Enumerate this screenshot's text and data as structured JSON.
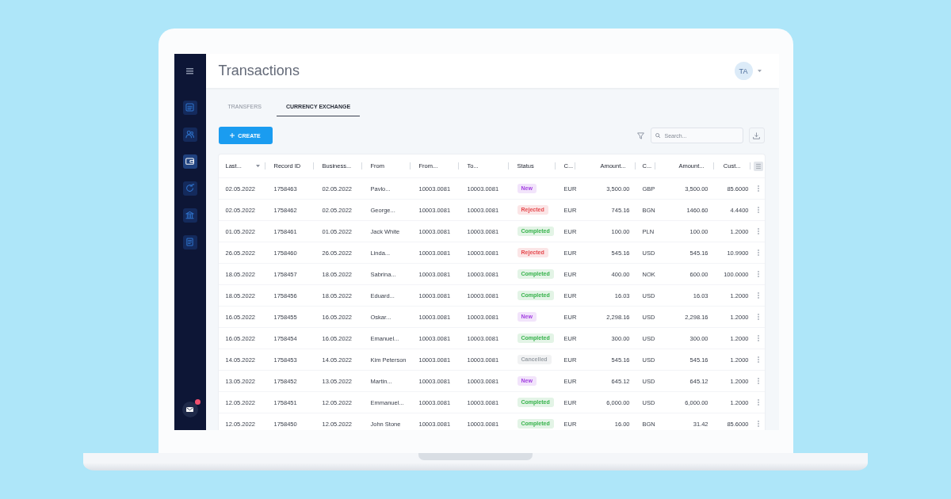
{
  "sidebar": {
    "items": [
      {
        "kind": "list",
        "selected": false
      },
      {
        "kind": "users",
        "selected": false
      },
      {
        "kind": "wallet",
        "selected": true
      },
      {
        "kind": "refresh",
        "selected": false
      },
      {
        "kind": "bank",
        "selected": false
      },
      {
        "kind": "document",
        "selected": false
      }
    ],
    "messages": {
      "unread": true
    }
  },
  "header": {
    "title": "Transactions",
    "avatar": "TA"
  },
  "tabs": [
    {
      "label": "TRANSFERS",
      "selected": false
    },
    {
      "label": "CURRENCY EXCHANGE",
      "selected": true
    }
  ],
  "toolbar": {
    "create_button": "CREATE",
    "search": {
      "placeholder": "Search..."
    }
  },
  "table": {
    "columns": [
      {
        "label": "Last...",
        "kind": "text",
        "sorted": true
      },
      {
        "label": "Record ID",
        "kind": "text",
        "sorted": false
      },
      {
        "label": "Business...",
        "kind": "text",
        "sorted": false
      },
      {
        "label": "From",
        "kind": "text",
        "sorted": false
      },
      {
        "label": "From...",
        "kind": "text",
        "sorted": false
      },
      {
        "label": "To...",
        "kind": "text",
        "sorted": false
      },
      {
        "label": "Status",
        "kind": "tag",
        "sorted": false
      },
      {
        "label": "C...",
        "kind": "text",
        "sorted": false
      },
      {
        "label": "Amount...",
        "kind": "number",
        "sorted": false
      },
      {
        "label": "C...",
        "kind": "text",
        "sorted": false
      },
      {
        "label": "Amount...",
        "kind": "number",
        "sorted": false
      },
      {
        "label": "Cust...",
        "kind": "number",
        "sorted": false
      }
    ],
    "rows": [
      {
        "cells": [
          "02.05.2022",
          "1758463",
          "02.05.2022",
          "Pavlo...",
          "10003.0081",
          "10003.0081",
          "New",
          "EUR",
          "3,500.00",
          "GBP",
          "3,500.00",
          "85.6000"
        ],
        "color": "#a23fe0"
      },
      {
        "cells": [
          "02.05.2022",
          "1758462",
          "02.05.2022",
          "George...",
          "10003.0081",
          "10003.0081",
          "Rejected",
          "EUR",
          "745.16",
          "BGN",
          "1460.60",
          "4.4400"
        ],
        "color": "#e5484d"
      },
      {
        "cells": [
          "01.05.2022",
          "1758461",
          "01.05.2022",
          "Jack White",
          "10003.0081",
          "10003.0081",
          "Completed",
          "EUR",
          "100.00",
          "PLN",
          "100.00",
          "1.2000"
        ],
        "color": "#35b24a"
      },
      {
        "cells": [
          "26.05.2022",
          "1758460",
          "26.05.2022",
          "Linda...",
          "10003.0081",
          "10003.0081",
          "Rejected",
          "EUR",
          "545.16",
          "USD",
          "545.16",
          "10.9900"
        ],
        "color": "#e5484d"
      },
      {
        "cells": [
          "18.05.2022",
          "1758457",
          "18.05.2022",
          "Sabrina...",
          "10003.0081",
          "10003.0081",
          "Completed",
          "EUR",
          "400.00",
          "NOK",
          "600.00",
          "100.0000"
        ],
        "color": "#35b24a"
      },
      {
        "cells": [
          "18.05.2022",
          "1758456",
          "18.05.2022",
          "Eduard...",
          "10003.0081",
          "10003.0081",
          "Completed",
          "EUR",
          "16.03",
          "USD",
          "16.03",
          "1.2000"
        ],
        "color": "#35b24a"
      },
      {
        "cells": [
          "16.05.2022",
          "1758455",
          "16.05.2022",
          "Oskar...",
          "10003.0081",
          "10003.0081",
          "New",
          "EUR",
          "2,298.16",
          "USD",
          "2,298.16",
          "1.2000"
        ],
        "color": "#a23fe0"
      },
      {
        "cells": [
          "16.05.2022",
          "1758454",
          "16.05.2022",
          "Emanuel...",
          "10003.0081",
          "10003.0081",
          "Completed",
          "EUR",
          "300.00",
          "USD",
          "300.00",
          "1.2000"
        ],
        "color": "#35b24a"
      },
      {
        "cells": [
          "14.05.2022",
          "1758453",
          "14.05.2022",
          "Kim Peterson",
          "10003.0081",
          "10003.0081",
          "Cancelled",
          "EUR",
          "545.16",
          "USD",
          "545.16",
          "1.2000"
        ],
        "color": "#9aa0a6"
      },
      {
        "cells": [
          "13.05.2022",
          "1758452",
          "13.05.2022",
          "Martin...",
          "10003.0081",
          "10003.0081",
          "New",
          "EUR",
          "645.12",
          "USD",
          "645.12",
          "1.2000"
        ],
        "color": "#a23fe0"
      },
      {
        "cells": [
          "12.05.2022",
          "1758451",
          "12.05.2022",
          "Emmanuel...",
          "10003.0081",
          "10003.0081",
          "Completed",
          "EUR",
          "6,000.00",
          "USD",
          "6,000.00",
          "1.2000"
        ],
        "color": "#35b24a"
      },
      {
        "cells": [
          "12.05.2022",
          "1758450",
          "12.05.2022",
          "John Stone",
          "10003.0081",
          "10003.0081",
          "Completed",
          "EUR",
          "16.00",
          "BGN",
          "31.42",
          "85.6000"
        ],
        "color": "#35b24a"
      }
    ]
  }
}
